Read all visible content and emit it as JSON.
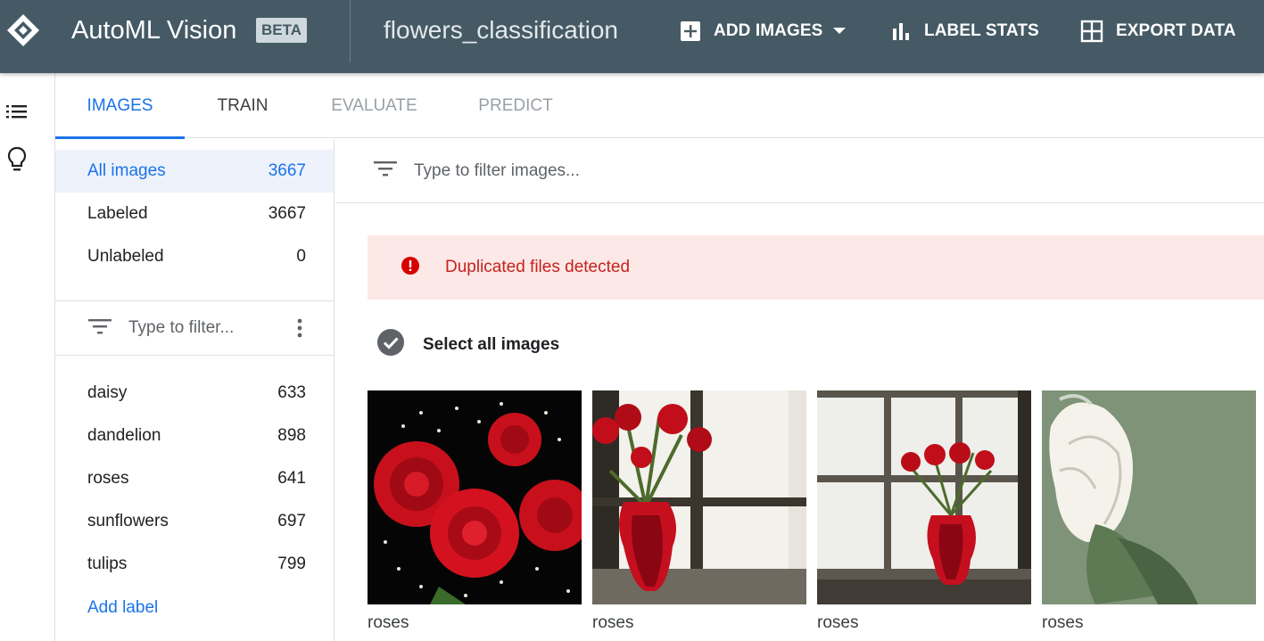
{
  "header": {
    "app_title": "AutoML Vision",
    "badge": "BETA",
    "dataset": "flowers_classification",
    "actions": {
      "add_images": "ADD IMAGES",
      "label_stats": "LABEL STATS",
      "export_data": "EXPORT DATA"
    }
  },
  "rail": {
    "icons": [
      "list-icon",
      "lightbulb-icon"
    ]
  },
  "tabs": [
    {
      "label": "IMAGES",
      "state": "active"
    },
    {
      "label": "TRAIN",
      "state": "enabled"
    },
    {
      "label": "EVALUATE",
      "state": "disabled"
    },
    {
      "label": "PREDICT",
      "state": "disabled"
    }
  ],
  "sidebar": {
    "counts": [
      {
        "label": "All images",
        "count": "3667"
      },
      {
        "label": "Labeled",
        "count": "3667"
      },
      {
        "label": "Unlabeled",
        "count": "0"
      }
    ],
    "label_filter_placeholder": "Type to filter...",
    "labels": [
      {
        "label": "daisy",
        "count": "633"
      },
      {
        "label": "dandelion",
        "count": "898"
      },
      {
        "label": "roses",
        "count": "641"
      },
      {
        "label": "sunflowers",
        "count": "697"
      },
      {
        "label": "tulips",
        "count": "799"
      }
    ],
    "add_label": "Add label"
  },
  "main": {
    "filter_placeholder": "Type to filter images...",
    "alert": "Duplicated files detected",
    "select_all": "Select all images",
    "images": [
      {
        "label": "roses"
      },
      {
        "label": "roses"
      },
      {
        "label": "roses"
      },
      {
        "label": "roses"
      }
    ]
  },
  "colors": {
    "header_bg": "#455a64",
    "accent": "#1a73e8",
    "alert_bg": "#fce8e6",
    "alert_text": "#c5221f",
    "active_row_bg": "#edf2fb"
  }
}
